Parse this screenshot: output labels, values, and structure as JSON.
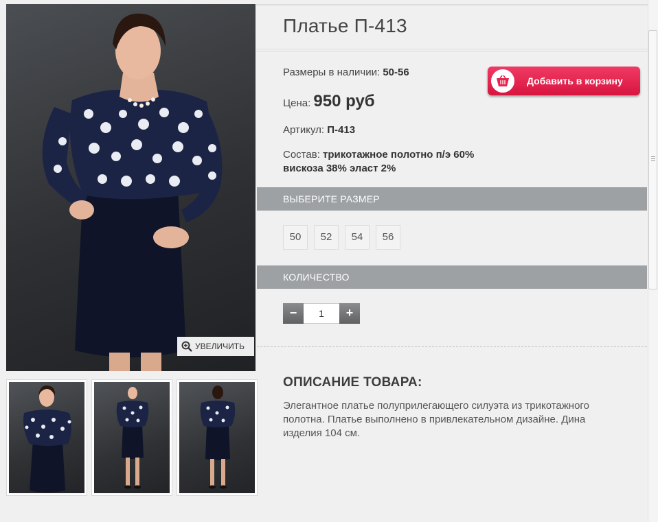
{
  "product": {
    "title": "Платье П-413",
    "sizes_label": "Размеры в наличии:",
    "sizes_value": "50-56",
    "price_label": "Цена:",
    "price_value": "950 руб",
    "sku_label": "Артикул:",
    "sku_value": "П-413",
    "composition_label": "Состав:",
    "composition_value": "трикотажное полотно п/э 60% вискоза 38% эласт 2%"
  },
  "cart": {
    "label": "Добавить в корзину",
    "icon": "basket-icon"
  },
  "gallery": {
    "zoom_label": "УВЕЛИЧИТЬ",
    "zoom_icon": "zoom-in-icon",
    "thumbnails": [
      "front-view",
      "full-length-front",
      "back-view"
    ]
  },
  "size_section": {
    "title": "ВЫБЕРИТЕ РАЗМЕР",
    "sizes": [
      "50",
      "52",
      "54",
      "56"
    ]
  },
  "quantity_section": {
    "title": "КОЛИЧЕСТВО",
    "minus": "−",
    "plus": "+",
    "value": "1"
  },
  "description": {
    "title": "ОПИСАНИЕ ТОВАРА:",
    "text": "Элегантное платье полуприлегающего силуэта из трикотажного полотна. Платье выполнено в привлекательном дизайне. Дина изделия 104 см."
  },
  "colors": {
    "cart_button": "#e8234f",
    "section_bar": "#9ea1a3",
    "page_bg": "#f0f0f0"
  }
}
